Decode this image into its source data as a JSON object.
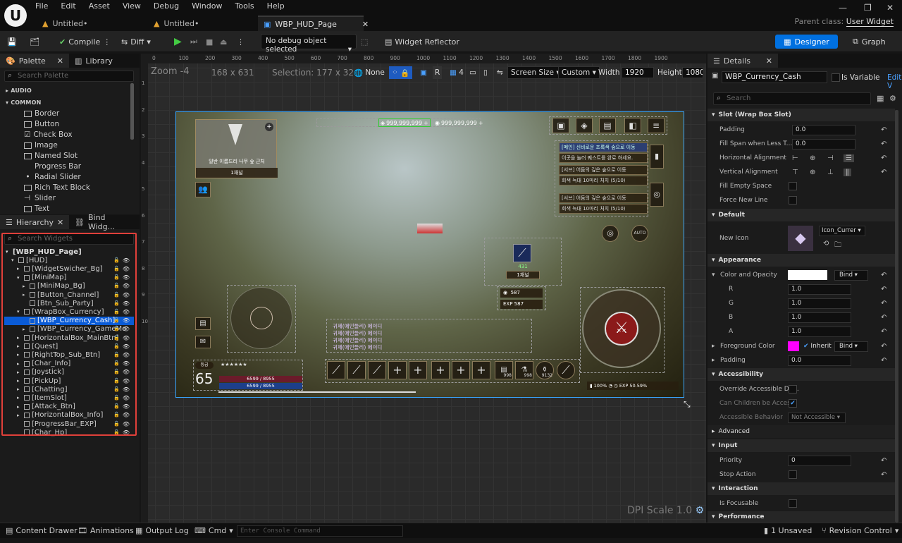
{
  "menubar": {
    "items": [
      "File",
      "Edit",
      "Asset",
      "View",
      "Debug",
      "Window",
      "Tools",
      "Help"
    ],
    "tabs": [
      {
        "label": "Untitled•"
      },
      {
        "label": "Untitled•"
      },
      {
        "label": "WBP_HUD_Page"
      }
    ],
    "parent_class_label": "Parent class:",
    "parent_class_value": "User Widget"
  },
  "toolbar": {
    "compile_label": "Compile",
    "diff_label": "Diff",
    "debug_object": "No debug object selected",
    "widget_reflector_label": "Widget Reflector",
    "designer_label": "Designer",
    "graph_label": "Graph"
  },
  "palette": {
    "tab_label": "Palette",
    "library_tab": "Library",
    "search_placeholder": "Search Palette",
    "categories": [
      "AUDIO",
      "COMMON"
    ],
    "items": [
      "Border",
      "Button",
      "Check Box",
      "Image",
      "Named Slot",
      "Progress Bar",
      "Radial Slider",
      "Rich Text Block",
      "Slider",
      "Text"
    ]
  },
  "hierarchy": {
    "tab_label": "Hierarchy",
    "bind_tab": "Bind Widg...",
    "search_placeholder": "Search Widgets",
    "items": [
      {
        "label": "[WBP_HUD_Page]"
      },
      {
        "label": "[HUD]"
      },
      {
        "label": "[WidgetSwicher_Bg]"
      },
      {
        "label": "[MiniMap]"
      },
      {
        "label": "[MiniMap_Bg]"
      },
      {
        "label": "[Button_Channel]"
      },
      {
        "label": "[Btn_Sub_Party]"
      },
      {
        "label": "[WrapBox_Currency]"
      },
      {
        "label": "[WBP_Currency_Cash]"
      },
      {
        "label": "[WBP_Currency_GameMo"
      },
      {
        "label": "[HorizontalBox_MainBtn]"
      },
      {
        "label": "[Quest]"
      },
      {
        "label": "[RightTop_Sub_Btn]"
      },
      {
        "label": "[Char_Info]"
      },
      {
        "label": "[Joystick]"
      },
      {
        "label": "[PickUp]"
      },
      {
        "label": "[Chatting]"
      },
      {
        "label": "[ItemSlot]"
      },
      {
        "label": "[Attack_Btn]"
      },
      {
        "label": "[HorizontalBox_Info]"
      },
      {
        "label": "[ProgressBar_EXP]"
      },
      {
        "label": "[Char_Hp]"
      }
    ]
  },
  "viewport": {
    "zoom": "Zoom -4",
    "size": "168 x 631",
    "selection": "Selection: 177 x 32",
    "none_label": "None",
    "grid_value": "4",
    "r_label": "R",
    "screen_size_label": "Screen Size",
    "custom_label": "Custom",
    "width_label": "Width",
    "width_value": "1920",
    "height_label": "Height",
    "height_value": "1080",
    "dpi_scale": "DPI Scale 1.0",
    "ruler_top": [
      "0",
      "100",
      "200",
      "300",
      "400",
      "500",
      "600",
      "700",
      "800",
      "900",
      "1000",
      "1100",
      "1200",
      "1300",
      "1400",
      "1500",
      "1600",
      "1700",
      "1800",
      "1900"
    ],
    "ruler_left": [
      "1",
      "2",
      "3",
      "4",
      "5",
      "6",
      "7",
      "8",
      "9",
      "10"
    ]
  },
  "hud": {
    "cash_value": "999,999,999",
    "gold_value": "999,999,999",
    "minimap_label": "일반 이름드리 나무 숲 근처",
    "channel_label": "1채널",
    "quests": [
      "[메인] 신비로운 조록색 숲으로 이동",
      "이곳을 눌러 퀘스트를 완료 하세요.",
      "[서브] 어둠의 깊은 숲으로 이동",
      "회색 늑대 10마리 처치 (5/10)",
      "[서브] 어둠의 깊은 숲으로 이동",
      "회색 늑대 10마리 처치 (5/10)"
    ],
    "auto_label": "AUTO",
    "pickup_count": "431",
    "pickup_channel": "1채널",
    "gold_drop": "587",
    "exp_drop": "EXP 587",
    "chat_lines": [
      "귀제(에인들리) 에이디",
      "귀제(에인들리) 에이디",
      "귀제(에인들리) 에이디",
      "귀제(에인들리) 에이디"
    ],
    "level_badge": "등급",
    "level": "65",
    "hp": "6599 / 8955",
    "mp": "6599 / 8955",
    "slot_counts": [
      "998",
      "998",
      "9132"
    ],
    "battery": "100%",
    "exp_pct": "EXP 50.59%"
  },
  "details": {
    "tab_label": "Details",
    "widget_name": "WBP_Currency_Cash",
    "is_variable_label": "Is Variable",
    "edit_label": "Edit V",
    "search_placeholder": "Search",
    "sections": {
      "slot": "Slot (Wrap Box Slot)",
      "default": "Default",
      "appearance": "Appearance",
      "accessibility": "Accessibility",
      "advanced": "Advanced",
      "input": "Input",
      "interaction": "Interaction",
      "performance": "Performance"
    },
    "padding_label": "Padding",
    "padding_value": "0.0",
    "fill_span_label": "Fill Span when Less T...",
    "fill_span_value": "0.0",
    "h_align_label": "Horizontal Alignment",
    "v_align_label": "Vertical Alignment",
    "fill_empty_label": "Fill Empty Space",
    "force_new_line_label": "Force New Line",
    "new_icon_label": "New Icon",
    "icon_value": "Icon_Currer",
    "color_opacity_label": "Color and Opacity",
    "bind_label": "Bind",
    "r_label": "R",
    "r_value": "1.0",
    "g_label": "G",
    "g_value": "1.0",
    "b_label": "B",
    "b_value": "1.0",
    "a_label": "A",
    "a_value": "1.0",
    "fg_color_label": "Foreground Color",
    "inherit_label": "Inherit",
    "padding2_label": "Padding",
    "padding2_value": "0.0",
    "override_access_label": "Override Accessible De...",
    "can_children_label": "Can Children be Acces...",
    "access_behavior_label": "Accessible Behavior",
    "access_behavior_value": "Not Accessible",
    "priority_label": "Priority",
    "priority_value": "0",
    "stop_action_label": "Stop Action",
    "is_focusable_label": "Is Focusable",
    "fg_color": "#ff00ff",
    "color_opacity_color": "#ffffff"
  },
  "bottombar": {
    "content_drawer": "Content Drawer",
    "animations": "Animations",
    "output_log": "Output Log",
    "cmd": "Cmd",
    "console_placeholder": "Enter Console Command",
    "unsaved": "1 Unsaved",
    "revision_control": "Revision Control"
  }
}
